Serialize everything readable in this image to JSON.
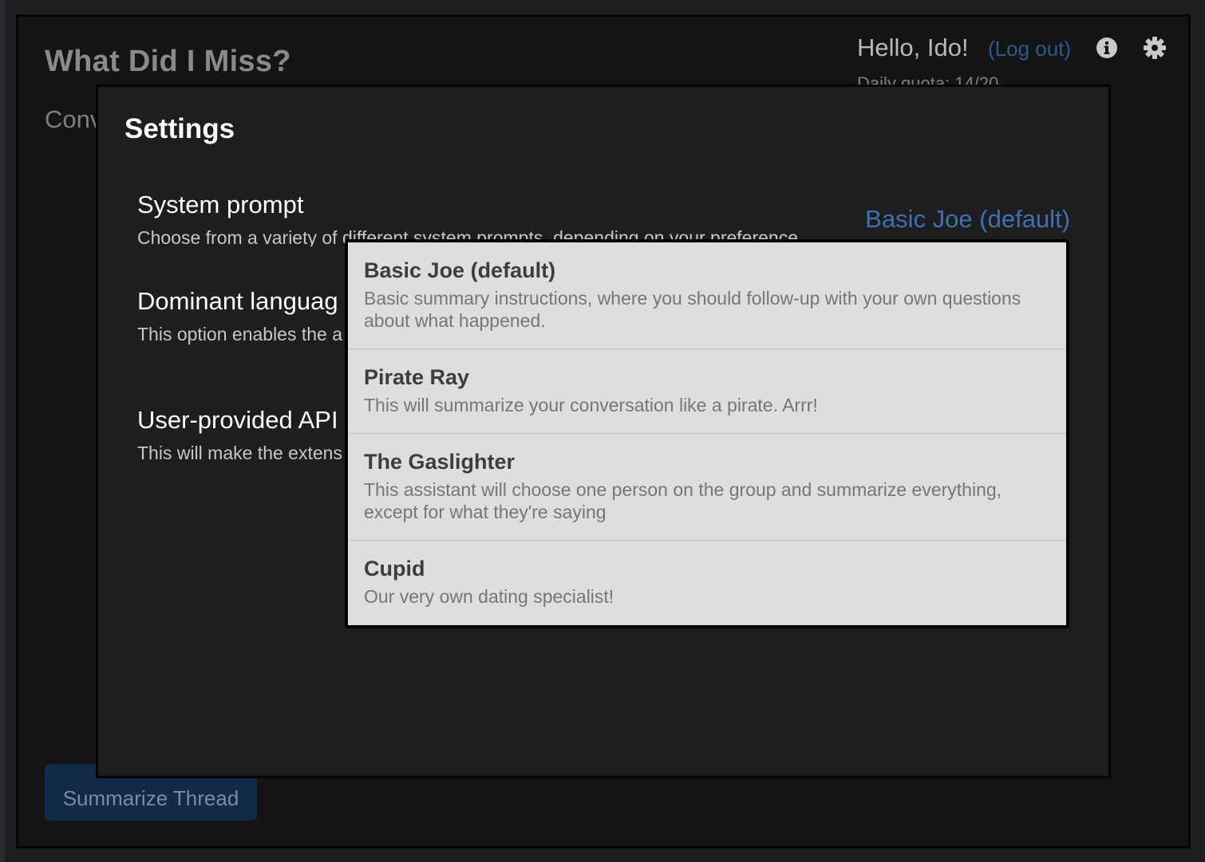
{
  "app": {
    "title": "What Did I Miss?",
    "conversation_label": "Conv",
    "greeting": "Hello, Ido!",
    "logout_label": "(Log out)",
    "daily_quota": "Daily quota: 14/20",
    "summarize_label": "Summarize Thread"
  },
  "icons": {
    "info": "info-icon",
    "settings": "gear-icon"
  },
  "colors": {
    "accent_link": "#3c72b4",
    "button_bg": "#13294a",
    "modal_bg": "#1e1e1e",
    "dropdown_bg": "#dedede"
  },
  "settings": {
    "title": "Settings",
    "system_prompt": {
      "title": "System prompt",
      "description": "Choose from a variety of different system prompts, depending on your preference",
      "selected": "Basic Joe (default)"
    },
    "dominant_language": {
      "title": "Dominant languag",
      "description": "This option enables the a conversation."
    },
    "api_key": {
      "title": "User-provided API",
      "description": "This will make the extens anyone else. Notice: this"
    }
  },
  "dropdown": {
    "options": [
      {
        "label": "Basic Joe (default)",
        "description": "Basic summary instructions, where you should follow-up with your own questions about what happened."
      },
      {
        "label": "Pirate Ray",
        "description": "This will summarize your conversation like a pirate. Arrr!"
      },
      {
        "label": "The Gaslighter",
        "description": "This assistant will choose one person on the group and summarize everything, except for what they're saying"
      },
      {
        "label": "Cupid",
        "description": "Our very own dating specialist!"
      }
    ]
  }
}
